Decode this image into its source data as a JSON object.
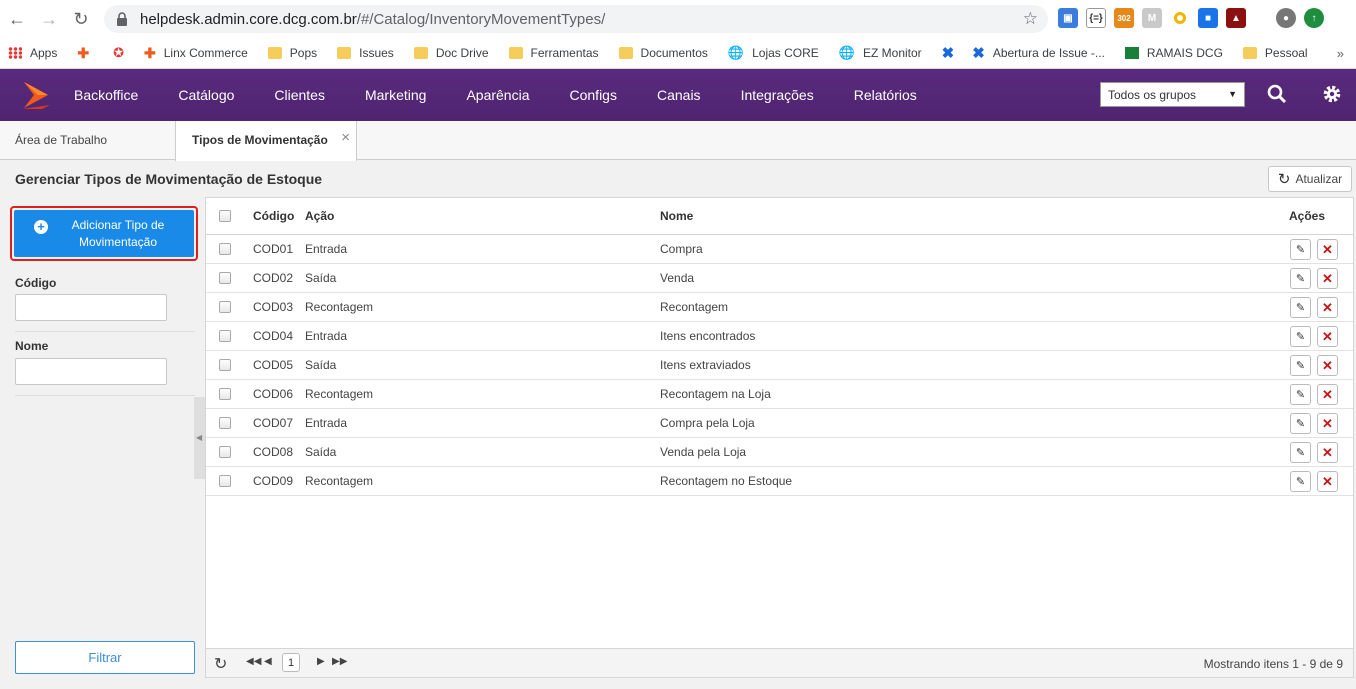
{
  "browser": {
    "url_host": "helpdesk.admin.core.dcg.com.br",
    "url_path": "/#/Catalog/InventoryMovementTypes/",
    "bookmarks": [
      "Apps",
      "",
      "",
      "Linx Commerce",
      "Pops",
      "Issues",
      "Doc Drive",
      "Ferramentas",
      "Documentos",
      "Lojas CORE",
      "EZ Monitor",
      "",
      "Abertura de Issue -...",
      "RAMAIS DCG",
      "Pessoal"
    ],
    "ext_badge": "302"
  },
  "header": {
    "menu": [
      "Backoffice",
      "Catálogo",
      "Clientes",
      "Marketing",
      "Aparência",
      "Configs",
      "Canais",
      "Integrações",
      "Relatórios"
    ],
    "group_select": "Todos os grupos"
  },
  "tabs": {
    "home": "Área de Trabalho",
    "active": "Tipos de Movimentação de Estoque"
  },
  "page": {
    "title": "Gerenciar Tipos de Movimentação de Estoque",
    "refresh_label": "Atualizar"
  },
  "sidebar": {
    "add_button": "Adicionar Tipo de Movimentação",
    "code_label": "Código",
    "code_value": "",
    "name_label": "Nome",
    "name_value": "",
    "filter_button": "Filtrar"
  },
  "grid": {
    "columns": {
      "code": "Código",
      "action": "Ação",
      "name": "Nome",
      "actions": "Ações"
    },
    "rows": [
      {
        "code": "COD01",
        "action": "Entrada",
        "name": "Compra"
      },
      {
        "code": "COD02",
        "action": "Saída",
        "name": "Venda"
      },
      {
        "code": "COD03",
        "action": "Recontagem",
        "name": "Recontagem"
      },
      {
        "code": "COD04",
        "action": "Entrada",
        "name": "Itens encontrados"
      },
      {
        "code": "COD05",
        "action": "Saída",
        "name": "Itens extraviados"
      },
      {
        "code": "COD06",
        "action": "Recontagem",
        "name": "Recontagem na Loja"
      },
      {
        "code": "COD07",
        "action": "Entrada",
        "name": "Compra pela Loja"
      },
      {
        "code": "COD08",
        "action": "Saída",
        "name": "Venda pela Loja"
      },
      {
        "code": "COD09",
        "action": "Recontagem",
        "name": "Recontagem no Estoque"
      }
    ],
    "pager": {
      "page": "1",
      "info": "Mostrando itens 1 - 9 de 9"
    }
  },
  "colors": {
    "header_purple": "#5a2a7e",
    "primary_blue": "#1a8ae8",
    "delete_red": "#c81414",
    "logo_orange": "#f05a1a"
  }
}
